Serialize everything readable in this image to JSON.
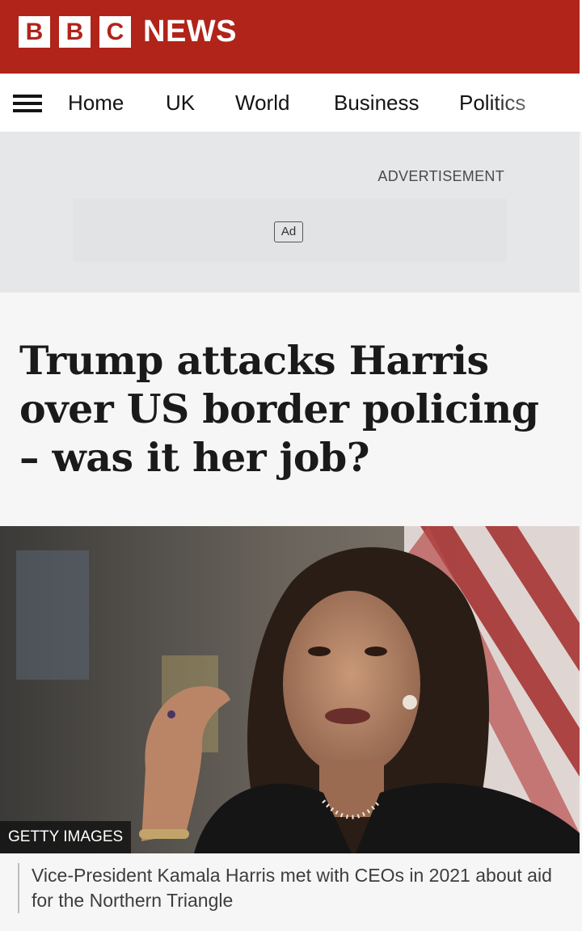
{
  "brand": {
    "letters": [
      "B",
      "B",
      "C"
    ],
    "name": "NEWS",
    "accent_color": "#b0241a"
  },
  "nav": {
    "items": [
      "Home",
      "UK",
      "World",
      "Business",
      "Politics"
    ]
  },
  "advertisement": {
    "label": "ADVERTISEMENT",
    "badge": "Ad"
  },
  "article": {
    "headline": "Trump attacks Harris over US border policing – was it her job?",
    "image_credit": "GETTY IMAGES",
    "image_caption": "Vice-President Kamala Harris met with CEOs in 2021 about aid for the Northern Triangle"
  }
}
